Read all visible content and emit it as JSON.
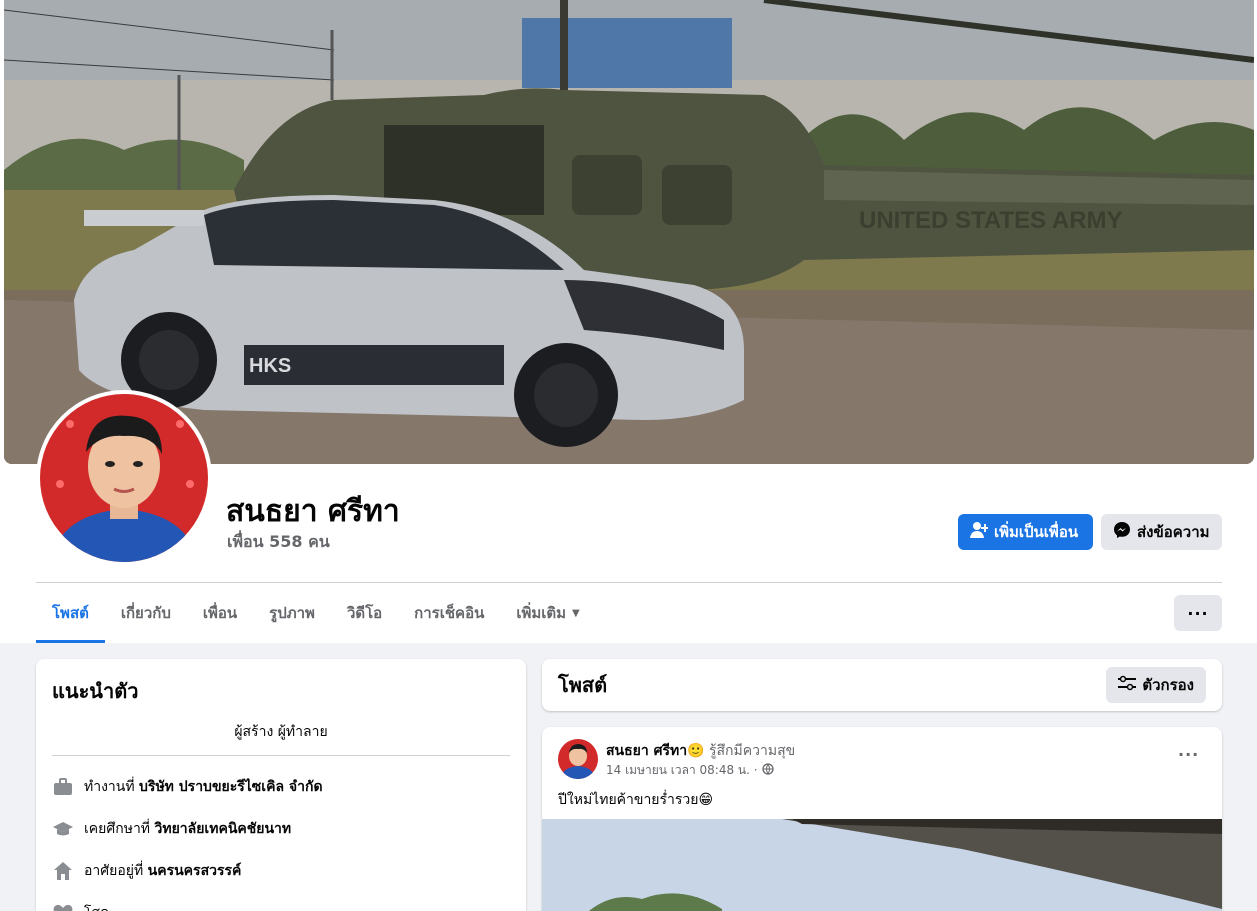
{
  "profile": {
    "name": "สนธยา ศรีทา",
    "friends_label": "เพื่อน 558 คน"
  },
  "actions": {
    "add_friend": "เพิ่มเป็นเพื่อน",
    "message": "ส่งข้อความ"
  },
  "tabs": [
    {
      "label": "โพสต์",
      "active": true
    },
    {
      "label": "เกี่ยวกับ"
    },
    {
      "label": "เพื่อน"
    },
    {
      "label": "รูปภาพ"
    },
    {
      "label": "วิดีโอ"
    },
    {
      "label": "การเช็คอิน"
    },
    {
      "label": "เพิ่มเติม"
    }
  ],
  "more_button": "···",
  "intro": {
    "title": "แนะนำตัว",
    "bio": "ผู้สร้าง ผู้ทำลาย",
    "rows": [
      {
        "icon": "briefcase-icon",
        "prefix": "ทำงานที่",
        "value": "บริษัท ปราบขยะรีไซเคิล จำกัด"
      },
      {
        "icon": "graduation-cap-icon",
        "prefix": "เคยศึกษาที่",
        "value": "วิทยาลัยเทคนิคชัยนาท"
      },
      {
        "icon": "home-icon",
        "prefix": "อาศัยอยู่ที่",
        "value": "นครนครสวรรค์"
      },
      {
        "icon": "heart-icon",
        "prefix": "",
        "value": "โสด"
      }
    ]
  },
  "posts_header": {
    "title": "โพสต์",
    "filter_label": "ตัวกรอง"
  },
  "post": {
    "author": "สนธยา ศรีทา",
    "feeling": "🙂 รู้สึกมีความสุข",
    "date": "14 เมษายน เวลา 08:48 น. ·",
    "text": "ปีใหม่ไทยค้าขายร่ำรวย😁",
    "dots": "···"
  },
  "colors": {
    "primary": "#1b74e4",
    "background": "#f0f2f5",
    "secondary_button": "#e4e6eb",
    "muted_text": "#65676b"
  }
}
